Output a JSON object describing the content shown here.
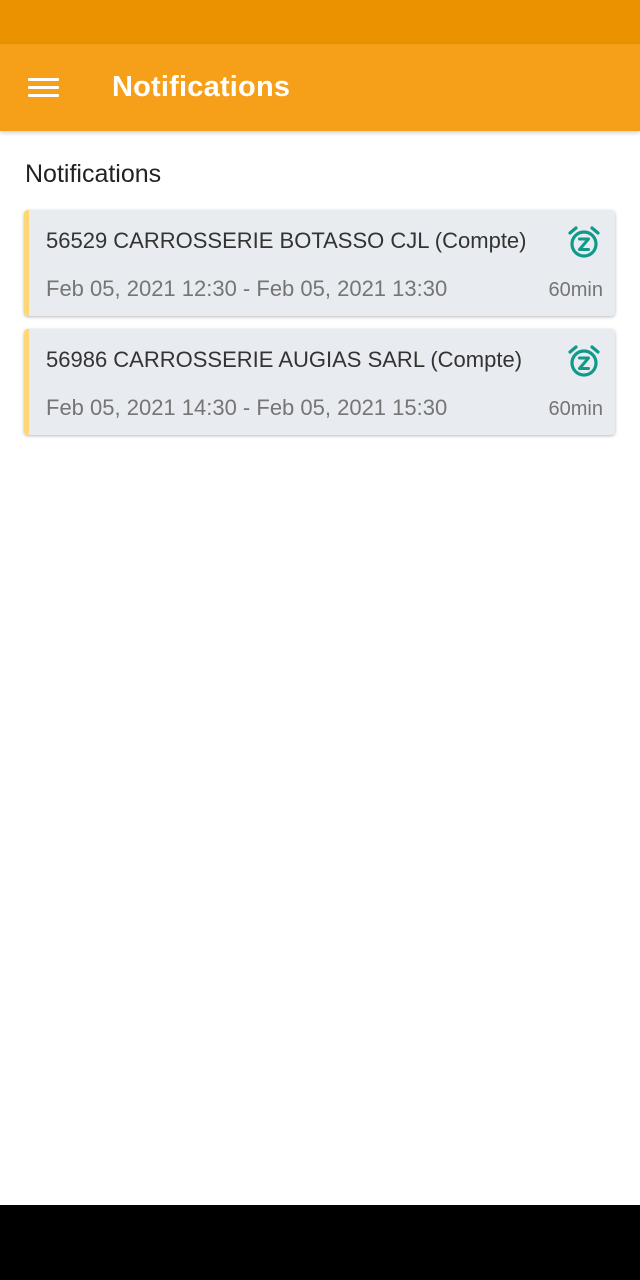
{
  "app_bar": {
    "title": "Notifications",
    "menu_icon": "hamburger-menu-icon",
    "background_color": "#f6a01a",
    "status_bar_color": "#ea9200"
  },
  "main": {
    "section_title": "Notifications",
    "notifications": [
      {
        "title": "56529 CARROSSERIE BOTASSO CJL (Compte)",
        "time_range": "Feb 05, 2021 12:30 - Feb 05, 2021 13:30",
        "duration": "60min",
        "icon": "snooze-alarm-icon"
      },
      {
        "title": "56986 CARROSSERIE AUGIAS SARL (Compte)",
        "time_range": "Feb 05, 2021 14:30 - Feb 05, 2021 15:30",
        "duration": "60min",
        "icon": "snooze-alarm-icon"
      }
    ],
    "card_accent_color": "#ffd776",
    "icon_color": "#11998a"
  }
}
